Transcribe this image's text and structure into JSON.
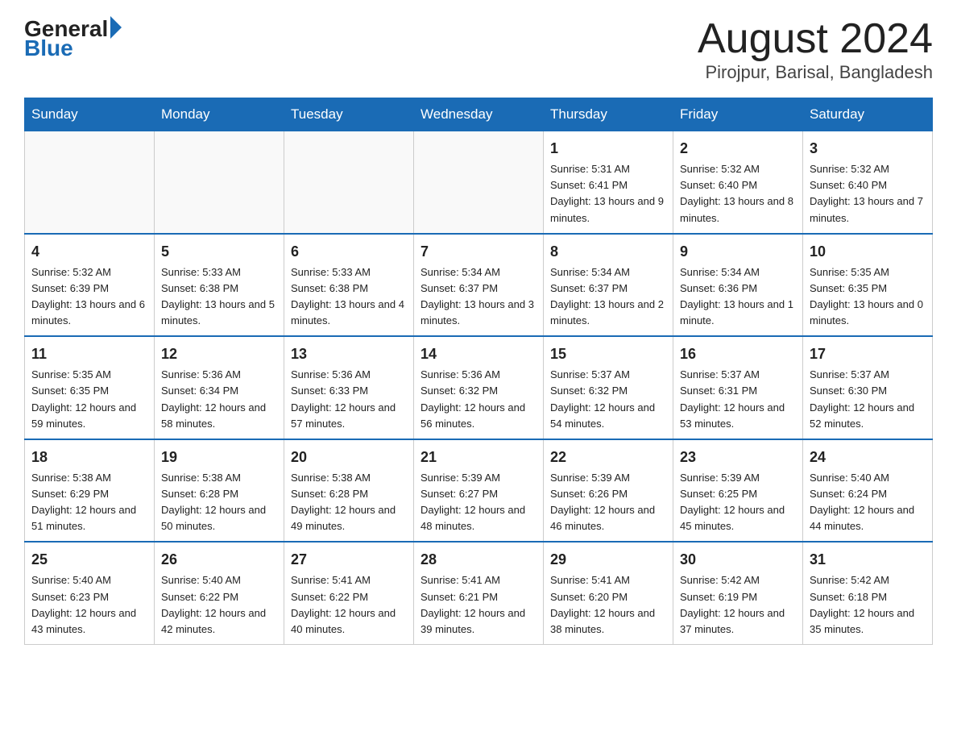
{
  "logo": {
    "general": "General",
    "triangle": "",
    "blue": "Blue"
  },
  "title": "August 2024",
  "subtitle": "Pirojpur, Barisal, Bangladesh",
  "days_of_week": [
    "Sunday",
    "Monday",
    "Tuesday",
    "Wednesday",
    "Thursday",
    "Friday",
    "Saturday"
  ],
  "weeks": [
    [
      {
        "day": "",
        "info": ""
      },
      {
        "day": "",
        "info": ""
      },
      {
        "day": "",
        "info": ""
      },
      {
        "day": "",
        "info": ""
      },
      {
        "day": "1",
        "info": "Sunrise: 5:31 AM\nSunset: 6:41 PM\nDaylight: 13 hours and 9 minutes."
      },
      {
        "day": "2",
        "info": "Sunrise: 5:32 AM\nSunset: 6:40 PM\nDaylight: 13 hours and 8 minutes."
      },
      {
        "day": "3",
        "info": "Sunrise: 5:32 AM\nSunset: 6:40 PM\nDaylight: 13 hours and 7 minutes."
      }
    ],
    [
      {
        "day": "4",
        "info": "Sunrise: 5:32 AM\nSunset: 6:39 PM\nDaylight: 13 hours and 6 minutes."
      },
      {
        "day": "5",
        "info": "Sunrise: 5:33 AM\nSunset: 6:38 PM\nDaylight: 13 hours and 5 minutes."
      },
      {
        "day": "6",
        "info": "Sunrise: 5:33 AM\nSunset: 6:38 PM\nDaylight: 13 hours and 4 minutes."
      },
      {
        "day": "7",
        "info": "Sunrise: 5:34 AM\nSunset: 6:37 PM\nDaylight: 13 hours and 3 minutes."
      },
      {
        "day": "8",
        "info": "Sunrise: 5:34 AM\nSunset: 6:37 PM\nDaylight: 13 hours and 2 minutes."
      },
      {
        "day": "9",
        "info": "Sunrise: 5:34 AM\nSunset: 6:36 PM\nDaylight: 13 hours and 1 minute."
      },
      {
        "day": "10",
        "info": "Sunrise: 5:35 AM\nSunset: 6:35 PM\nDaylight: 13 hours and 0 minutes."
      }
    ],
    [
      {
        "day": "11",
        "info": "Sunrise: 5:35 AM\nSunset: 6:35 PM\nDaylight: 12 hours and 59 minutes."
      },
      {
        "day": "12",
        "info": "Sunrise: 5:36 AM\nSunset: 6:34 PM\nDaylight: 12 hours and 58 minutes."
      },
      {
        "day": "13",
        "info": "Sunrise: 5:36 AM\nSunset: 6:33 PM\nDaylight: 12 hours and 57 minutes."
      },
      {
        "day": "14",
        "info": "Sunrise: 5:36 AM\nSunset: 6:32 PM\nDaylight: 12 hours and 56 minutes."
      },
      {
        "day": "15",
        "info": "Sunrise: 5:37 AM\nSunset: 6:32 PM\nDaylight: 12 hours and 54 minutes."
      },
      {
        "day": "16",
        "info": "Sunrise: 5:37 AM\nSunset: 6:31 PM\nDaylight: 12 hours and 53 minutes."
      },
      {
        "day": "17",
        "info": "Sunrise: 5:37 AM\nSunset: 6:30 PM\nDaylight: 12 hours and 52 minutes."
      }
    ],
    [
      {
        "day": "18",
        "info": "Sunrise: 5:38 AM\nSunset: 6:29 PM\nDaylight: 12 hours and 51 minutes."
      },
      {
        "day": "19",
        "info": "Sunrise: 5:38 AM\nSunset: 6:28 PM\nDaylight: 12 hours and 50 minutes."
      },
      {
        "day": "20",
        "info": "Sunrise: 5:38 AM\nSunset: 6:28 PM\nDaylight: 12 hours and 49 minutes."
      },
      {
        "day": "21",
        "info": "Sunrise: 5:39 AM\nSunset: 6:27 PM\nDaylight: 12 hours and 48 minutes."
      },
      {
        "day": "22",
        "info": "Sunrise: 5:39 AM\nSunset: 6:26 PM\nDaylight: 12 hours and 46 minutes."
      },
      {
        "day": "23",
        "info": "Sunrise: 5:39 AM\nSunset: 6:25 PM\nDaylight: 12 hours and 45 minutes."
      },
      {
        "day": "24",
        "info": "Sunrise: 5:40 AM\nSunset: 6:24 PM\nDaylight: 12 hours and 44 minutes."
      }
    ],
    [
      {
        "day": "25",
        "info": "Sunrise: 5:40 AM\nSunset: 6:23 PM\nDaylight: 12 hours and 43 minutes."
      },
      {
        "day": "26",
        "info": "Sunrise: 5:40 AM\nSunset: 6:22 PM\nDaylight: 12 hours and 42 minutes."
      },
      {
        "day": "27",
        "info": "Sunrise: 5:41 AM\nSunset: 6:22 PM\nDaylight: 12 hours and 40 minutes."
      },
      {
        "day": "28",
        "info": "Sunrise: 5:41 AM\nSunset: 6:21 PM\nDaylight: 12 hours and 39 minutes."
      },
      {
        "day": "29",
        "info": "Sunrise: 5:41 AM\nSunset: 6:20 PM\nDaylight: 12 hours and 38 minutes."
      },
      {
        "day": "30",
        "info": "Sunrise: 5:42 AM\nSunset: 6:19 PM\nDaylight: 12 hours and 37 minutes."
      },
      {
        "day": "31",
        "info": "Sunrise: 5:42 AM\nSunset: 6:18 PM\nDaylight: 12 hours and 35 minutes."
      }
    ]
  ]
}
